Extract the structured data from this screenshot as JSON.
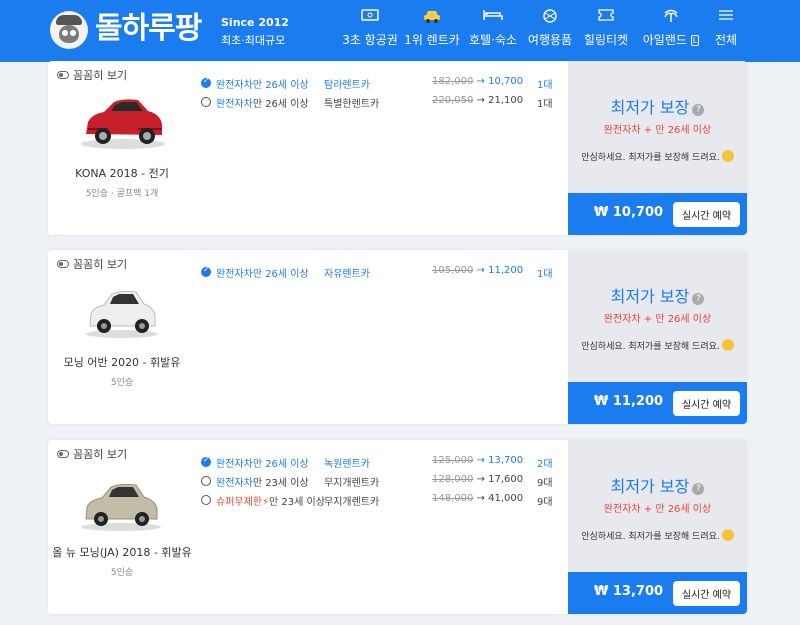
{
  "header": {
    "brand": "돌하루팡",
    "since": "Since 2012",
    "slogan": "최초·최대규모",
    "nav": [
      {
        "label": "3초 항공권",
        "icon": "ticket-icon"
      },
      {
        "label": "1위 렌트카",
        "icon": "car-icon"
      },
      {
        "label": "호텔·숙소",
        "icon": "bed-icon"
      },
      {
        "label": "여행용품",
        "icon": "gift-icon"
      },
      {
        "label": "힐링티켓",
        "icon": "coupon-icon"
      },
      {
        "label": "아일랜드 ",
        "badge": "L",
        "icon": "palm-tree-icon"
      },
      {
        "label": "전체",
        "icon": "menu-icon"
      }
    ]
  },
  "labels": {
    "toggle": "꼼꼼히 보기",
    "arrow": "→",
    "guarantee_title": "최저가 보장",
    "guarantee_q": "?",
    "guarantee_note": "안심하세요. 최저가를 보장해 드려요.",
    "book": "실시간 예약",
    "won": "₩"
  },
  "cars": [
    {
      "name": "KONA 2018 - 전기",
      "spec": "5인승 · 골프백 1개",
      "guarantee_cond": "완전자차 + 만 26세 이상",
      "final_price": "10,700",
      "options": [
        {
          "kind": "완전자차",
          "age": "만 26세 이상",
          "company": "탐라렌트카",
          "orig": "182,000",
          "price": "10,700",
          "count": "1대",
          "selected": true
        },
        {
          "kind": "완전자차",
          "age": "만 26세 이상",
          "company": "특별한렌트카",
          "orig": "220,050",
          "price": "21,100",
          "count": "1대",
          "selected": false
        }
      ]
    },
    {
      "name": "모닝 어반 2020 - 휘발유",
      "spec": "5인승",
      "guarantee_cond": "완전자차 + 만 26세 이상",
      "final_price": "11,200",
      "options": [
        {
          "kind": "완전자차",
          "age": "만 26세 이상",
          "company": "자유렌트카",
          "orig": "105,000",
          "price": "11,200",
          "count": "1대",
          "selected": true
        }
      ]
    },
    {
      "name": "올 뉴 모닝(JA) 2018 - 휘발유",
      "spec": "5인승",
      "guarantee_cond": "완전자차 + 만 26세 이상",
      "final_price": "13,700",
      "options": [
        {
          "kind": "완전자차",
          "age": "만 26세 이상",
          "company": "녹원렌트카",
          "orig": "125,000",
          "price": "13,700",
          "count": "2대",
          "selected": true
        },
        {
          "kind": "완전자차",
          "age": "만 23세 이상",
          "company": "무지개렌트카",
          "orig": "128,000",
          "price": "17,600",
          "count": "9대",
          "selected": false
        },
        {
          "kind": "슈퍼무제한",
          "age": "만 23세 이상",
          "company": "무지개렌트카",
          "orig": "148,000",
          "price": "41,000",
          "count": "9대",
          "selected": false,
          "bolt": true
        }
      ]
    }
  ],
  "colors": {
    "primary": "#1b7cf0",
    "accent_red": "#e8443a",
    "car1": "#c8202a",
    "car2": "#eeeeee",
    "car3": "#c4bda5"
  }
}
